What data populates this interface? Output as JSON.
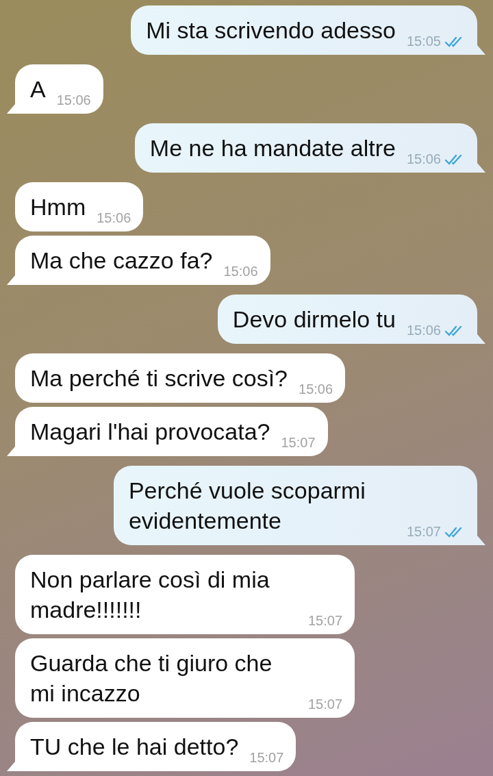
{
  "messages": [
    {
      "kind": "outgoing",
      "text": "Mi sta scrivendo adesso",
      "time": "15:05",
      "read": true
    },
    {
      "kind": "incoming",
      "text": "A",
      "time": "15:06"
    },
    {
      "kind": "outgoing",
      "text": "Me ne ha mandate altre",
      "time": "15:06",
      "read": true
    },
    {
      "kind": "incoming",
      "text": "Hmm",
      "time": "15:06"
    },
    {
      "kind": "incoming",
      "text": "Ma che cazzo fa?",
      "time": "15:06"
    },
    {
      "kind": "outgoing",
      "text": "Devo dirmelo tu",
      "time": "15:06",
      "read": true
    },
    {
      "kind": "incoming",
      "text": "Ma perché ti scrive così?",
      "time": "15:06"
    },
    {
      "kind": "incoming",
      "text": "Magari l'hai provocata?",
      "time": "15:07"
    },
    {
      "kind": "outgoing",
      "text": "Perché vuole scoparmi evidentemente",
      "time": "15:07",
      "read": true
    },
    {
      "kind": "incoming",
      "text": "Non parlare così di mia madre!!!!!!!",
      "time": "15:07"
    },
    {
      "kind": "incoming",
      "text": "Guarda che ti giuro che mi incazzo",
      "time": "15:07"
    },
    {
      "kind": "incoming",
      "text": "TU che le hai detto?",
      "time": "15:07"
    }
  ]
}
